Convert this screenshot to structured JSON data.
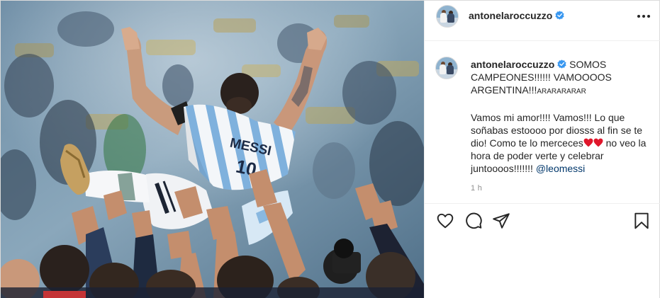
{
  "post": {
    "username": "antonelaroccuzzo",
    "verified": true,
    "caption": {
      "username": "antonelaroccuzzo",
      "text_main": "SOMOS CAMPEONES!!!!!! VAMOOOOS ARGENTINA!!!",
      "text_small": "ARARARARAR",
      "line2_part1": "Vamos mi amor!!!! Vamos!!! Lo que soñabas estoooo por diosss al fin se te dio! Como te lo merceces",
      "line2_part2": "no veo la hora de poder verte y celebrar juntoooos!!!!!!!",
      "mention": "@leomessi",
      "emoji": [
        "red-heart",
        "red-heart"
      ]
    },
    "time_ago": "1 h",
    "photo": {
      "jersey_text": "MESSI",
      "jersey_number": "10"
    },
    "actions": [
      "like-icon",
      "comment-icon",
      "share-icon",
      "save-icon"
    ],
    "colors": {
      "verified_blue": "#3897f0",
      "heart_red": "#e0162b",
      "mention_blue": "#00376b",
      "jersey_sky_blue": "#75aadb"
    }
  }
}
